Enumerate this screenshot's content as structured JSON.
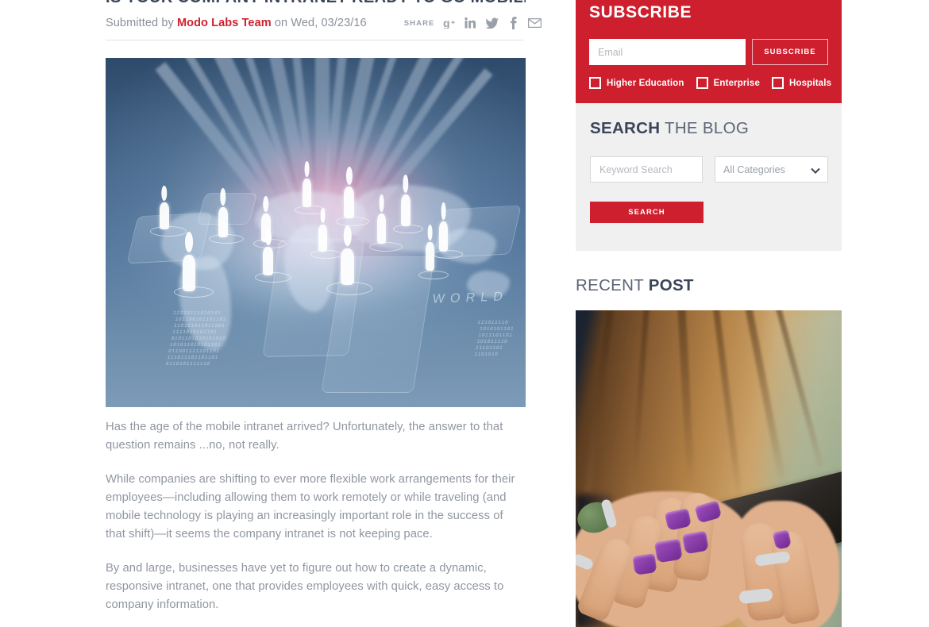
{
  "post": {
    "title": "IS YOUR COMPANY INTRANET READY TO GO MOBILE?",
    "byline_prefix": "Submitted by",
    "author": "Modo Labs Team",
    "byline_middle": "on",
    "date": "Wed, 03/23/16",
    "share_label": "SHARE",
    "share_icons": [
      {
        "name": "google-plus-icon",
        "label": "g+"
      },
      {
        "name": "linkedin-icon",
        "label": "in"
      },
      {
        "name": "twitter-icon",
        "label": "t"
      },
      {
        "name": "facebook-icon",
        "label": "f"
      },
      {
        "name": "email-icon",
        "label": "mail"
      }
    ],
    "hero_image_alt": "World map hologram with human figures and light rays",
    "paragraphs": [
      "Has the age of the mobile intranet arrived? Unfortunately, the answer to that question remains ...no, not really.",
      "While companies are shifting to ever more flexible work arrangements for their employees—including allowing them to work remotely or while traveling (and mobile technology is playing an increasingly important role in the success of that shift)—it seems the company intranet is not keeping pace.",
      "By and large, businesses have yet to figure out how to create a dynamic, responsive intranet, one that provides employees with quick, easy access to company information."
    ]
  },
  "sidebar": {
    "subscribe": {
      "title": "SUBSCRIBE",
      "email_placeholder": "Email",
      "email_value": "",
      "button_label": "SUBSCRIBE",
      "checkboxes": [
        {
          "label": "Higher Education",
          "checked": false
        },
        {
          "label": "Enterprise",
          "checked": false
        },
        {
          "label": "Hospitals",
          "checked": false
        }
      ],
      "bg_color": "#ce1f2e"
    },
    "search": {
      "heading_bold": "SEARCH",
      "heading_rest": " THE BLOG",
      "keyword_placeholder": "Keyword Search",
      "keyword_value": "",
      "category_selected": "All Categories",
      "button_label": "SEARCH",
      "panel_bg": "#f0f0f0"
    },
    "recent": {
      "heading_rest": "RECENT ",
      "heading_bold": "POST",
      "image_alt": "Woman with purple nail polish holding a smartphone"
    }
  },
  "colors": {
    "brand_red": "#ce1f2e",
    "heading_dark": "#3b4559",
    "body_text": "#9096a1",
    "muted": "#8a8f99",
    "panel_gray": "#f0f0f0"
  }
}
